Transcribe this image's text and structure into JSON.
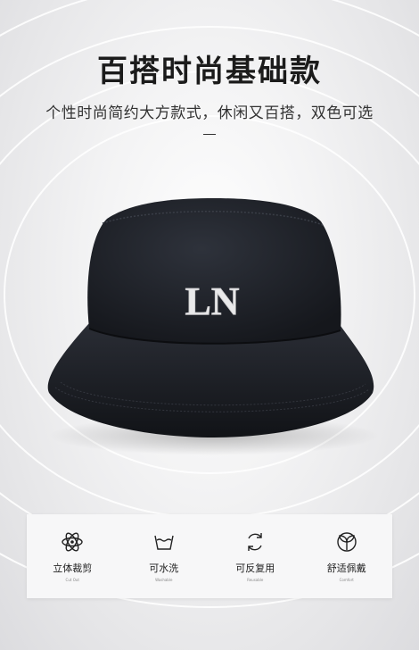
{
  "header": {
    "title": "百搭时尚基础款",
    "subtitle": "个性时尚简约大方款式，休闲又百搭，双色可选"
  },
  "product": {
    "logo_text": "LN"
  },
  "features": [
    {
      "label": "立体裁剪",
      "sub": "Cut Out",
      "icon": "atom-icon"
    },
    {
      "label": "可水洗",
      "sub": "Washable",
      "icon": "wash-basin-icon"
    },
    {
      "label": "可反复用",
      "sub": "Reusable",
      "icon": "recycle-arrows-icon"
    },
    {
      "label": "舒适佩戴",
      "sub": "Comfort",
      "icon": "sprout-icon"
    }
  ],
  "colors": {
    "hat": "#1d2027",
    "accent": "#1b1b1b"
  }
}
